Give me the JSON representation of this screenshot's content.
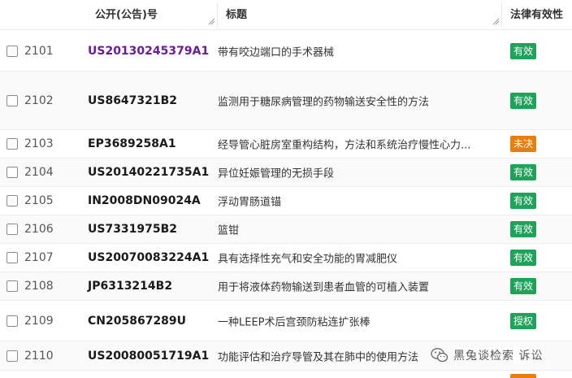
{
  "header": {
    "pub_label": "公开(公告)号",
    "title_label": "标题",
    "status_label": "法律有效性"
  },
  "colors": {
    "valid": "#1fa35b",
    "pending": "#e87e0e",
    "link": "#6a1b9a"
  },
  "rows": [
    {
      "num": "2101",
      "pub": "US20130245379A1",
      "title": "带有咬边端口的手术器械",
      "status": "有效",
      "kind": "valid",
      "link": true
    },
    {
      "num": "2102",
      "pub": "US8647321B2",
      "title": "监测用于糖尿病管理的药物输送安全性的方法",
      "status": "有效",
      "kind": "valid",
      "link": false
    },
    {
      "num": "2103",
      "pub": "EP3689258A1",
      "title": "经导管心脏房室重构结构，方法和系统治疗慢性心力...",
      "status": "未决",
      "kind": "pending",
      "link": false
    },
    {
      "num": "2104",
      "pub": "US20140221735A1",
      "title": "异位妊娠管理的无损手段",
      "status": "有效",
      "kind": "valid",
      "link": false
    },
    {
      "num": "2105",
      "pub": "IN2008DN09024A",
      "title": "浮动胃肠道锚",
      "status": "有效",
      "kind": "valid",
      "link": false
    },
    {
      "num": "2106",
      "pub": "US7331975B2",
      "title": "篮钳",
      "status": "有效",
      "kind": "valid",
      "link": false
    },
    {
      "num": "2107",
      "pub": "US20070083224A1",
      "title": "具有选择性充气和安全功能的胃减肥仪",
      "status": "有效",
      "kind": "valid",
      "link": false
    },
    {
      "num": "2108",
      "pub": "JP6313214B2",
      "title": "用于将液体药物输送到患者血管的可植入装置",
      "status": "有效",
      "kind": "valid",
      "link": false
    },
    {
      "num": "2109",
      "pub": "CN205867289U",
      "title": "一种LEEP术后宫颈防粘连扩张棒",
      "status": "授权",
      "kind": "valid",
      "link": false
    },
    {
      "num": "2110",
      "pub": "US20080051719A1",
      "title": "功能评估和治疗导管及其在肺中的使用方法",
      "status": "",
      "kind": "valid",
      "link": false
    }
  ],
  "watermark": {
    "text": "黑兔谈检索 诉讼",
    "icon": "wechat-icon"
  }
}
